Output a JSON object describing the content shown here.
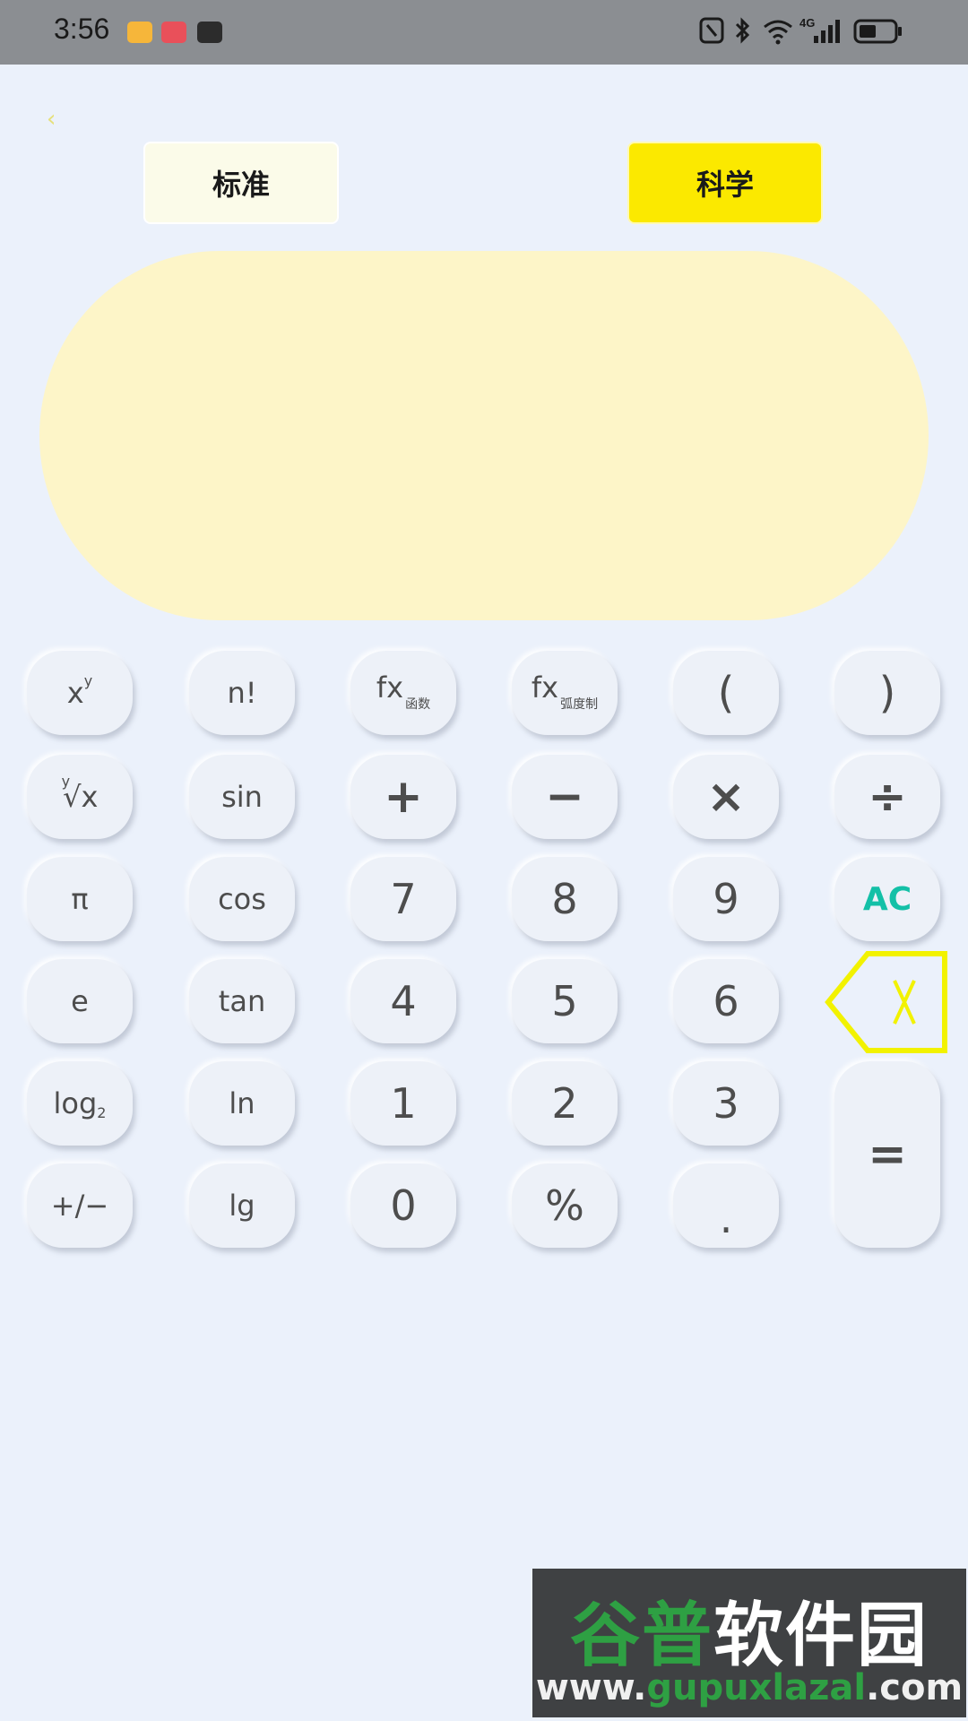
{
  "status_bar": {
    "time": "3:56",
    "network": "4G"
  },
  "nav": {
    "back_glyph": "‹"
  },
  "tabs": [
    {
      "label": "标准",
      "active": false
    },
    {
      "label": "科学",
      "active": true
    }
  ],
  "display": {
    "expression": "",
    "result": ""
  },
  "keys": {
    "xy": {
      "base": "x",
      "sup": "y"
    },
    "factorial": "n!",
    "fx_func": {
      "main": "fx",
      "sub": "函数"
    },
    "fx_radian": {
      "main": "fx",
      "sub": "弧度制"
    },
    "lparen": "(",
    "rparen": ")",
    "root": {
      "sup": "y",
      "main": "√x"
    },
    "sin": "sin",
    "plus": "+",
    "minus": "−",
    "times": "×",
    "divide": "÷",
    "pi": "π",
    "cos": "cos",
    "seven": "7",
    "eight": "8",
    "nine": "9",
    "ac": "AC",
    "e": "e",
    "tan": "tan",
    "four": "4",
    "five": "5",
    "six": "6",
    "log2": {
      "main": "log",
      "sub": "2"
    },
    "ln": "ln",
    "one": "1",
    "two": "2",
    "three": "3",
    "equals": "=",
    "sign": "+/−",
    "lg": "lg",
    "zero": "0",
    "percent": "%",
    "dot": "."
  },
  "colors": {
    "accent_yellow": "#fbe900",
    "ac_teal": "#13c0a7",
    "display_bg": "#fdf5c8",
    "backspace_outline": "#f2f200"
  },
  "watermark": {
    "cn_a": "谷普",
    "cn_b": "软件园",
    "url_a": "www.",
    "url_b": "gupuxlazal",
    "url_c": ".com"
  }
}
